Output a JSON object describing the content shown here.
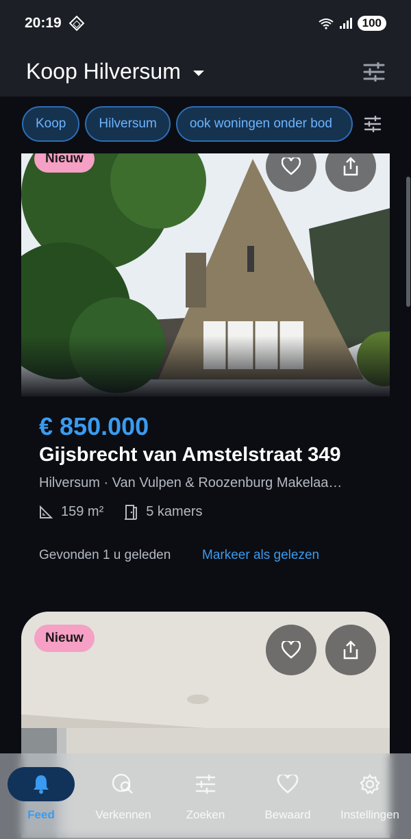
{
  "status_bar": {
    "time": "20:19",
    "battery": "100",
    "icons": [
      "diamond-icon",
      "wifi-icon",
      "signal-icon"
    ]
  },
  "header": {
    "title": "Koop Hilversum",
    "dropdown_icon": "chevron-down-icon",
    "filter_icon": "tune-icon"
  },
  "filters": {
    "chips": [
      "Koop",
      "Hilversum",
      "ook woningen onder bod"
    ],
    "tune_icon": "tune-icon"
  },
  "listings": [
    {
      "badge": "Nieuw",
      "price": "€ 850.000",
      "address": "Gijsbrecht van Amstelstraat 349",
      "subtitle": "Hilversum · Van Vulpen & Roozenburg Makelaa…",
      "area": "159 m²",
      "rooms": "5 kamers",
      "found": "Gevonden 1 u geleden",
      "mark_read": "Markeer als gelezen"
    },
    {
      "badge": "Nieuw"
    }
  ],
  "bottom_nav": {
    "items": [
      {
        "label": "Feed",
        "icon": "bell-icon",
        "active": true
      },
      {
        "label": "Verkennen",
        "icon": "explore-search-icon",
        "active": false
      },
      {
        "label": "Zoeken",
        "icon": "tune-icon",
        "active": false
      },
      {
        "label": "Bewaard",
        "icon": "heart-icon",
        "active": false
      },
      {
        "label": "Instellingen",
        "icon": "gear-icon",
        "active": false
      }
    ]
  },
  "colors": {
    "accent": "#3a9bf0",
    "badge": "#f5a0c4",
    "background": "#0b0d12",
    "header": "#1c1f26"
  }
}
